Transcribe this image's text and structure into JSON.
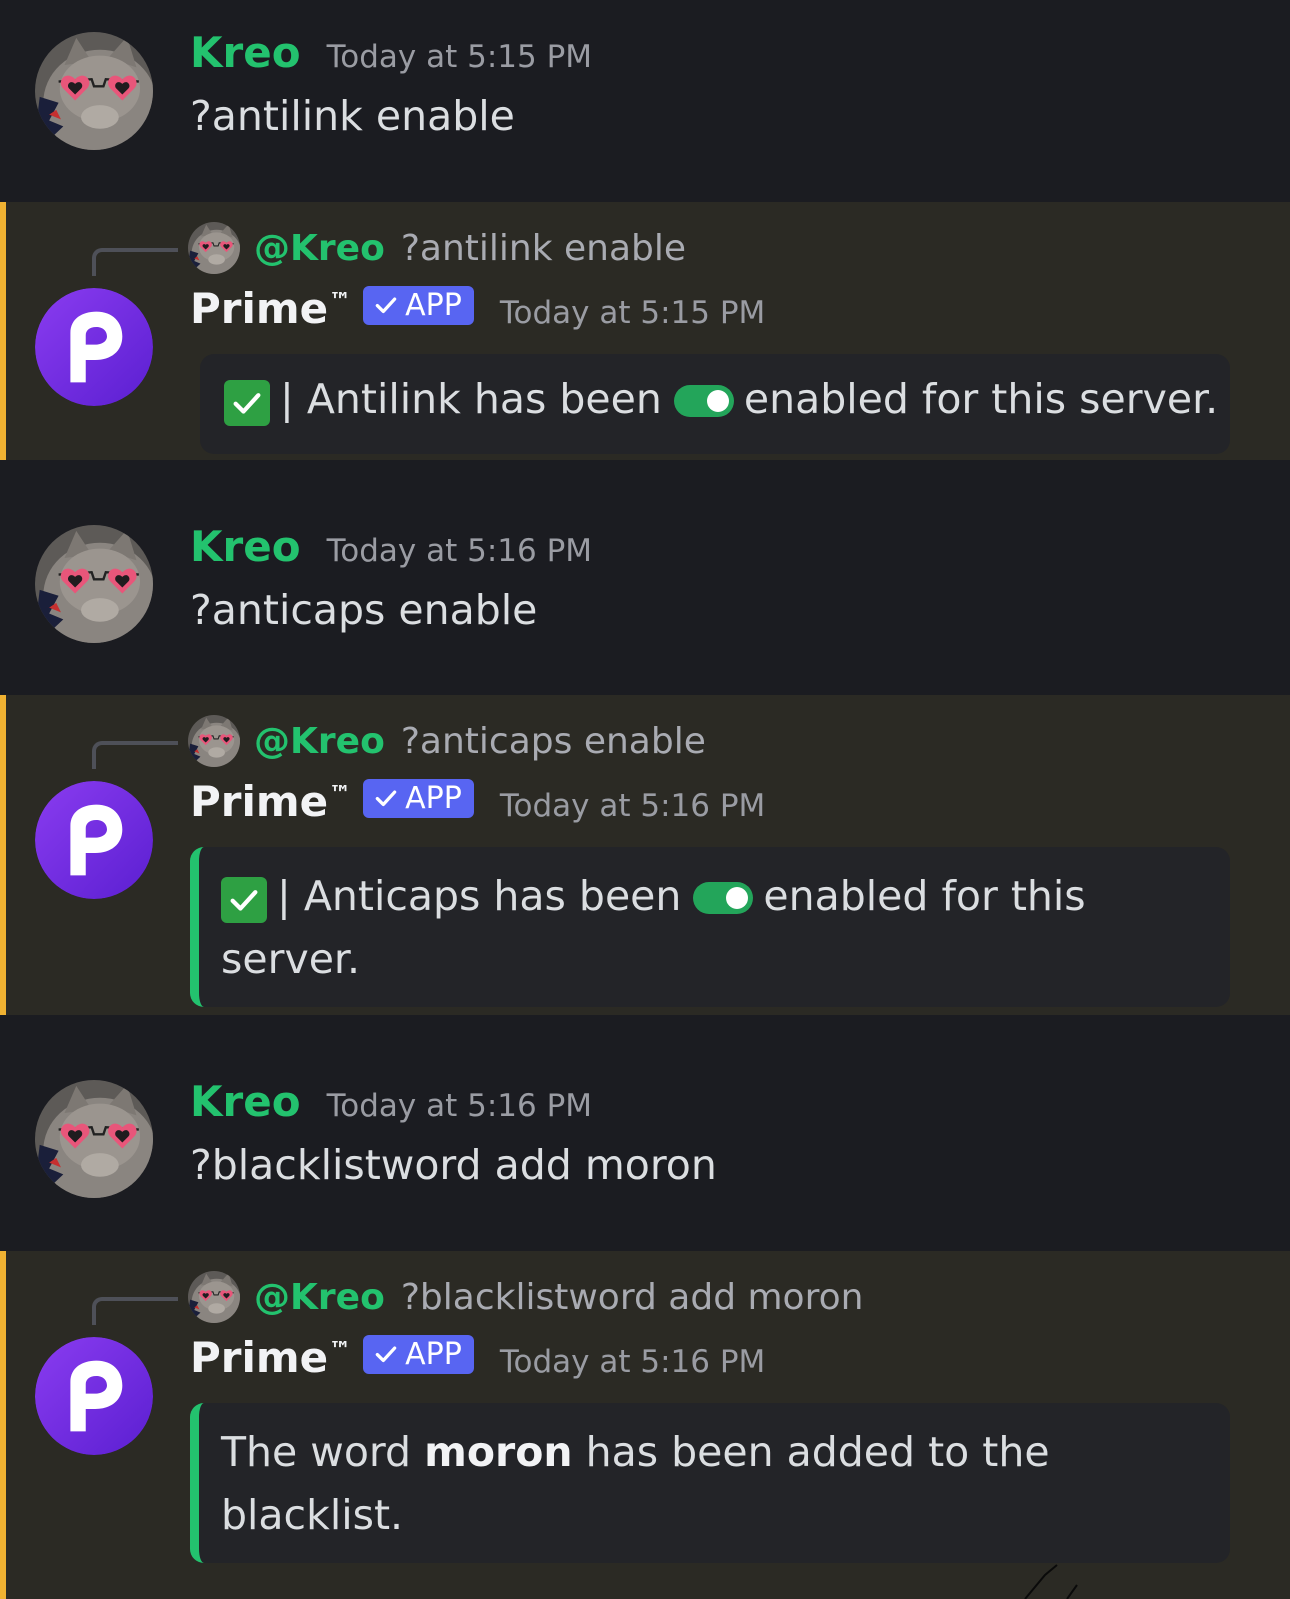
{
  "user_name": "Kreo",
  "bot_name": "Prime",
  "bot_tm": "™",
  "bot_badge": "APP",
  "messages": [
    {
      "time": "Today at 5:15 PM",
      "text": "?antilink enable"
    },
    {
      "reply_name": "@Kreo",
      "reply_text": "?antilink enable",
      "time": "Today at 5:15 PM",
      "embed_a": "| Antilink has been",
      "embed_b": "enabled for this server."
    },
    {
      "time": "Today at 5:16 PM",
      "text": "?anticaps enable"
    },
    {
      "reply_name": "@Kreo",
      "reply_text": "?anticaps enable",
      "time": "Today at 5:16 PM",
      "embed_a": "| Anticaps has been",
      "embed_b": "enabled for this",
      "embed_c": "server."
    },
    {
      "time": "Today at 5:16 PM",
      "text": "?blacklistword add moron"
    },
    {
      "reply_name": "@Kreo",
      "reply_text": "?blacklistword add moron",
      "time": "Today at 5:16 PM",
      "embed_a": "The word",
      "embed_bold": "moron",
      "embed_b": "has been added to the",
      "embed_c": "blacklist."
    }
  ],
  "colors": {
    "user_name": "#23c26e",
    "bot_band": "#2b2a24",
    "highlight_bar": "#f0b232",
    "embed_bar": "#23c26e",
    "app_badge": "#5865f2"
  }
}
